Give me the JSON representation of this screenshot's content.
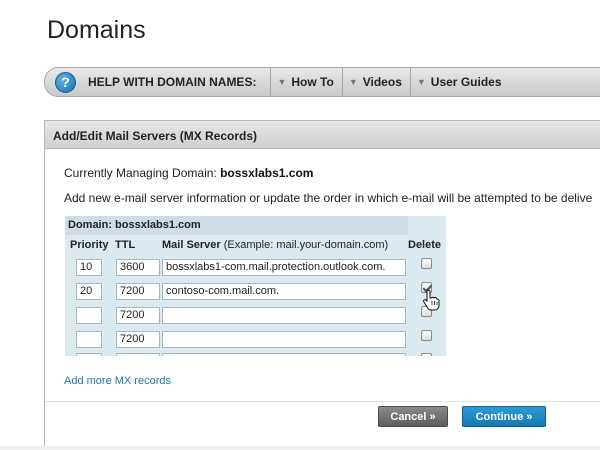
{
  "page": {
    "title": "Domains"
  },
  "helpbar": {
    "label": "HELP WITH DOMAIN NAMES:",
    "items": [
      {
        "label": "How To"
      },
      {
        "label": "Videos"
      },
      {
        "label": "User Guides"
      }
    ]
  },
  "panel": {
    "title": "Add/Edit Mail Servers (MX Records)",
    "managing_label": "Currently Managing Domain:",
    "managing_domain": "bossxlabs1.com",
    "instructions": "Add new e-mail server information or update the order in which e-mail will be attempted to be delive",
    "table": {
      "domain_label": "Domain: bossxlabs1.com",
      "headers": {
        "priority": "Priority",
        "ttl": "TTL",
        "server": "Mail Server",
        "server_example": "(Example: mail.your-domain.com)",
        "delete": "Delete"
      },
      "rows": [
        {
          "priority": "10",
          "ttl": "3600",
          "server": "bossxlabs1-com.mail.protection.outlook.com.",
          "delete": false
        },
        {
          "priority": "20",
          "ttl": "7200",
          "server": "contoso-com.mail.com.",
          "delete": true
        },
        {
          "priority": "",
          "ttl": "7200",
          "server": "",
          "delete": false
        },
        {
          "priority": "",
          "ttl": "7200",
          "server": "",
          "delete": false
        }
      ]
    },
    "add_more_link": "Add more MX records",
    "cancel_label": "Cancel »",
    "continue_label": "Continue »"
  },
  "colors": {
    "accent": "#1a82c4",
    "link": "#2277aa",
    "table_bg": "#dbe9f1"
  }
}
